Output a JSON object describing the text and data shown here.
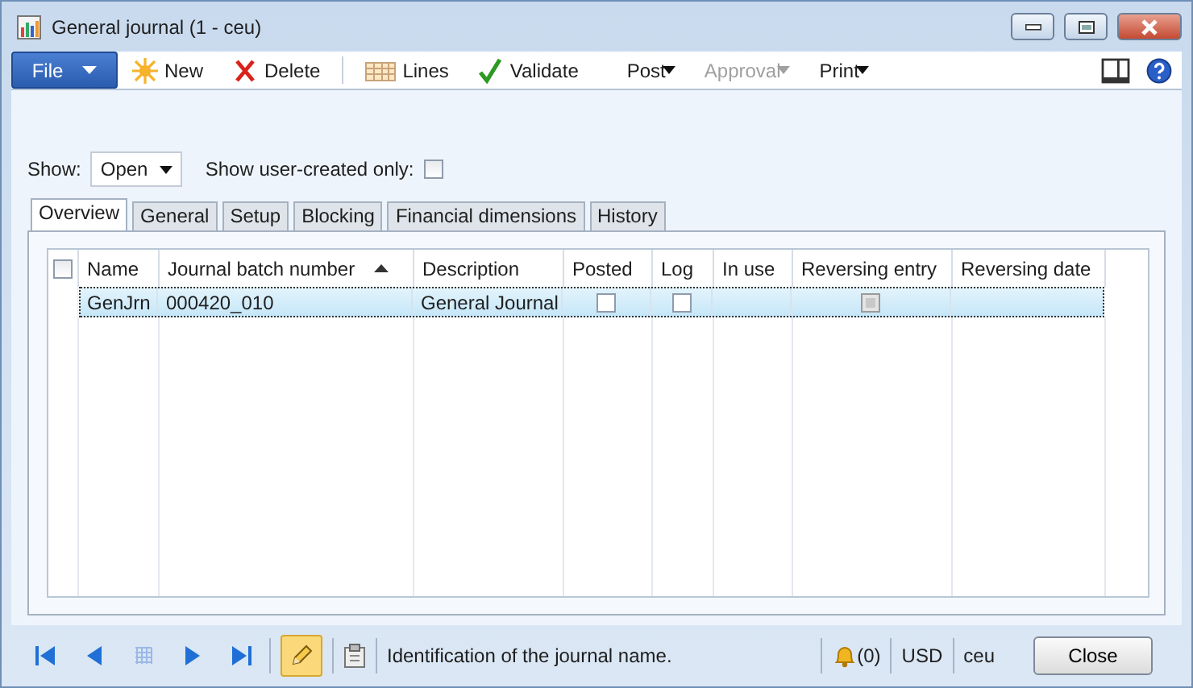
{
  "window": {
    "title": "General journal (1 - ceu)"
  },
  "toolbar": {
    "file_menu": "File",
    "items": [
      {
        "kind": "new",
        "label": "New",
        "dropdown": false,
        "disabled": false
      },
      {
        "kind": "delete",
        "label": "Delete",
        "dropdown": false,
        "disabled": false
      },
      {
        "kind": "lines",
        "label": "Lines",
        "dropdown": false,
        "disabled": false
      },
      {
        "kind": "validate",
        "label": "Validate",
        "dropdown": false,
        "disabled": false
      },
      {
        "kind": "plain",
        "label": "Post",
        "dropdown": true,
        "disabled": false
      },
      {
        "kind": "plain",
        "label": "Approval",
        "dropdown": true,
        "disabled": true
      },
      {
        "kind": "plain",
        "label": "Print",
        "dropdown": true,
        "disabled": false
      }
    ]
  },
  "filters": {
    "show_label": "Show:",
    "show_value": "Open",
    "user_created_label": "Show user-created only:",
    "user_created_checked": false
  },
  "tabs": [
    {
      "label": "Overview",
      "selected": true
    },
    {
      "label": "General",
      "selected": false
    },
    {
      "label": "Setup",
      "selected": false
    },
    {
      "label": "Blocking",
      "selected": false
    },
    {
      "label": "Financial dimensions",
      "selected": false
    },
    {
      "label": "History",
      "selected": false
    }
  ],
  "table": {
    "select_all_checked": false,
    "columns": [
      {
        "label": "Name",
        "sorted": false
      },
      {
        "label": "Journal batch number",
        "sorted": true
      },
      {
        "label": "Description",
        "sorted": false
      },
      {
        "label": "Posted",
        "sorted": false
      },
      {
        "label": "Log",
        "sorted": false
      },
      {
        "label": "In use",
        "sorted": false
      },
      {
        "label": "Reversing entry",
        "sorted": false
      },
      {
        "label": "Reversing date",
        "sorted": false
      }
    ],
    "rows": [
      {
        "selected": true,
        "cells": [
          {
            "kind": "text",
            "text": "GenJrn"
          },
          {
            "kind": "text",
            "text": "000420_010"
          },
          {
            "kind": "text",
            "text": "General Journal"
          },
          {
            "kind": "checkbox",
            "checked": false,
            "disabled": false
          },
          {
            "kind": "checkbox",
            "checked": false,
            "disabled": false
          },
          {
            "kind": "empty"
          },
          {
            "kind": "checkbox",
            "checked": false,
            "disabled": true
          },
          {
            "kind": "empty"
          }
        ]
      }
    ]
  },
  "status_bar": {
    "edit_mode": true,
    "message": "Identification of the journal name.",
    "notifications": "(0)",
    "currency": "USD",
    "company": "ceu",
    "close_button": "Close"
  }
}
